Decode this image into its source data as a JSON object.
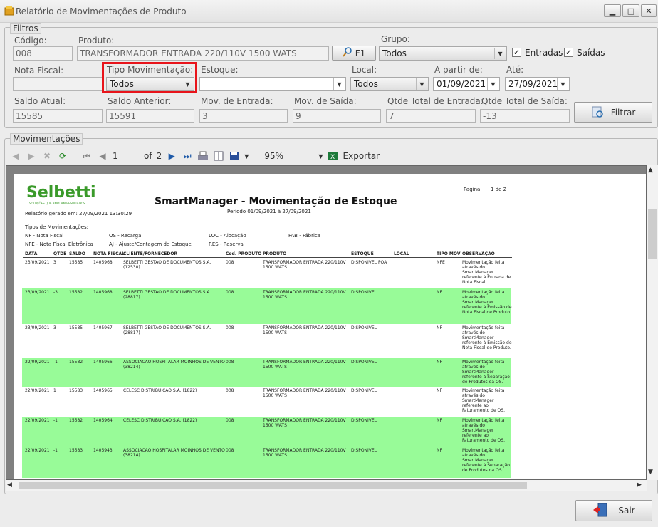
{
  "window": {
    "title": "Relatório de Movimentações de Produto"
  },
  "filters": {
    "group_label": "Filtros",
    "codigo_label": "Código:",
    "codigo_value": "008",
    "produto_label": "Produto:",
    "produto_value": "TRANSFORMADOR ENTRADA 220/110V 1500 WATS",
    "f1_label": "F1",
    "grupo_label": "Grupo:",
    "grupo_value": "Todos",
    "entradas_label": "Entradas",
    "saidas_label": "Saídas",
    "nota_fiscal_label": "Nota Fiscal:",
    "tipo_mov_label": "Tipo Movimentação:",
    "tipo_mov_value": "Todos",
    "estoque_label": "Estoque:",
    "estoque_value": "",
    "local_label": "Local:",
    "local_value": "Todos",
    "a_partir_label": "A partir de:",
    "a_partir_value": "01/09/2021",
    "ate_label": "Até:",
    "ate_value": "27/09/2021",
    "saldo_atual_label": "Saldo Atual:",
    "saldo_atual_value": "15585",
    "saldo_anterior_label": "Saldo Anterior:",
    "saldo_anterior_value": "15591",
    "mov_entrada_label": "Mov. de Entrada:",
    "mov_entrada_value": "3",
    "mov_saida_label": "Mov. de Saída:",
    "mov_saida_value": "9",
    "qtde_entrada_label": "Qtde Total de Entrada:",
    "qtde_entrada_value": "7",
    "qtde_saida_label": "Qtde Total de Saída:",
    "qtde_saida_value": "-13",
    "filtrar_label": "Filtrar"
  },
  "movimentacoes": {
    "group_label": "Movimentações",
    "toolbar": {
      "page": "1",
      "of": "of",
      "total": "2",
      "zoom": "95%",
      "export": "Exportar"
    }
  },
  "report": {
    "logo": "Selbetti",
    "logo_tagline": "SOLUÇÕES QUE AMPLIAM RESULTADOS",
    "title": "SmartManager - Movimentação de Estoque",
    "period": "Período 01/09/2021 à 27/09/2021",
    "page_label": "Pagina:",
    "page_value": "1 de 2",
    "generated": "Relatório gerado em:   27/09/2021 13:30:29",
    "types_title": "Tipos de Movimentações:",
    "types": [
      "NF - Nota Fiscal",
      "OS - Recarga",
      "LOC - Alocação",
      "FAB - Fábrica",
      "NFE - Nota Fiscal Eletrônica",
      "AJ - Ajuste/Contagem de Estoque",
      "RES - Reserva"
    ],
    "columns": [
      "DATA",
      "QTDE",
      "SALDO",
      "NOTA FISCAL",
      "CLIENTE/FORNECEDOR",
      "Cod. PRODUTO",
      "PRODUTO",
      "ESTOQUE",
      "LOCAL",
      "TIPO MOV",
      "OBSERVAÇÃO"
    ],
    "rows": [
      {
        "data": "23/09/2021",
        "qtde": "3",
        "saldo": "15585",
        "nf": "1405968",
        "cliente": "SELBETTI GESTAO DE DOCUMENTOS S.A. (12530)",
        "cod": "008",
        "produto": "TRANSFORMADOR ENTRADA 220/110V 1500 WATS",
        "estoque": "DISPONIVEL POA",
        "local": "",
        "tipo": "NFE",
        "obs": "Movimentação feita através do SmartManager referente à Entrada de Nota Fiscal.",
        "green": false
      },
      {
        "data": "23/09/2021",
        "qtde": "-3",
        "saldo": "15582",
        "nf": "1405968",
        "cliente": "SELBETTI GESTAO DE DOCUMENTOS S.A. (28817)",
        "cod": "008",
        "produto": "TRANSFORMADOR ENTRADA 220/110V 1500 WATS",
        "estoque": "DISPONIVEL",
        "local": "",
        "tipo": "NF",
        "obs": "Movimentação feita através do SmartManager referente à Emissão de Nota Fiscal de Produto.",
        "green": true
      },
      {
        "data": "23/09/2021",
        "qtde": "3",
        "saldo": "15585",
        "nf": "1405967",
        "cliente": "SELBETTI GESTAO DE DOCUMENTOS S.A. (28817)",
        "cod": "008",
        "produto": "TRANSFORMADOR ENTRADA 220/110V 1500 WATS",
        "estoque": "DISPONIVEL",
        "local": "",
        "tipo": "NF",
        "obs": "Movimentação feita através do SmartManager referente à Emissão de Nota Fiscal de Produto.",
        "green": false
      },
      {
        "data": "22/09/2021",
        "qtde": "-1",
        "saldo": "15582",
        "nf": "1405966",
        "cliente": "ASSOCIACAO HOSPITALAR MOINHOS DE VENTO (38214)",
        "cod": "008",
        "produto": "TRANSFORMADOR ENTRADA 220/110V 1500 WATS",
        "estoque": "DISPONIVEL",
        "local": "",
        "tipo": "NF",
        "obs": "Movimentação feita através do SmartManager referente à Separação de Produtos da OS.",
        "green": true
      },
      {
        "data": "22/09/2021",
        "qtde": "1",
        "saldo": "15583",
        "nf": "1405965",
        "cliente": "CELESC DISTRIBUICAO S.A. (1822)",
        "cod": "008",
        "produto": "TRANSFORMADOR ENTRADA 220/110V 1500 WATS",
        "estoque": "DISPONIVEL",
        "local": "",
        "tipo": "NF",
        "obs": "Movimentação feita através do SmartManager referente ao Faturamento de OS.",
        "green": false
      },
      {
        "data": "22/09/2021",
        "qtde": "-1",
        "saldo": "15582",
        "nf": "1405964",
        "cliente": "CELESC DISTRIBUICAO S.A. (1822)",
        "cod": "008",
        "produto": "TRANSFORMADOR ENTRADA 220/110V 1500 WATS",
        "estoque": "DISPONIVEL",
        "local": "",
        "tipo": "NF",
        "obs": "Movimentação feita através do SmartManager referente ao Faturamento de OS.",
        "green": true
      },
      {
        "data": "22/09/2021",
        "qtde": "-1",
        "saldo": "15583",
        "nf": "1405943",
        "cliente": "ASSOCIACAO HOSPITALAR MOINHOS DE VENTO (38214)",
        "cod": "008",
        "produto": "TRANSFORMADOR ENTRADA 220/110V 1500 WATS",
        "estoque": "DISPONIVEL",
        "local": "",
        "tipo": "NF",
        "obs": "Movimentação feita através do SmartManager referente à Separação de Produtos da OS.",
        "green": true
      }
    ]
  },
  "footer": {
    "sair_label": "Sair"
  },
  "colors": {
    "highlight": "#e8141b",
    "row_green": "#98fb98",
    "accent": "#1e5aa8"
  }
}
